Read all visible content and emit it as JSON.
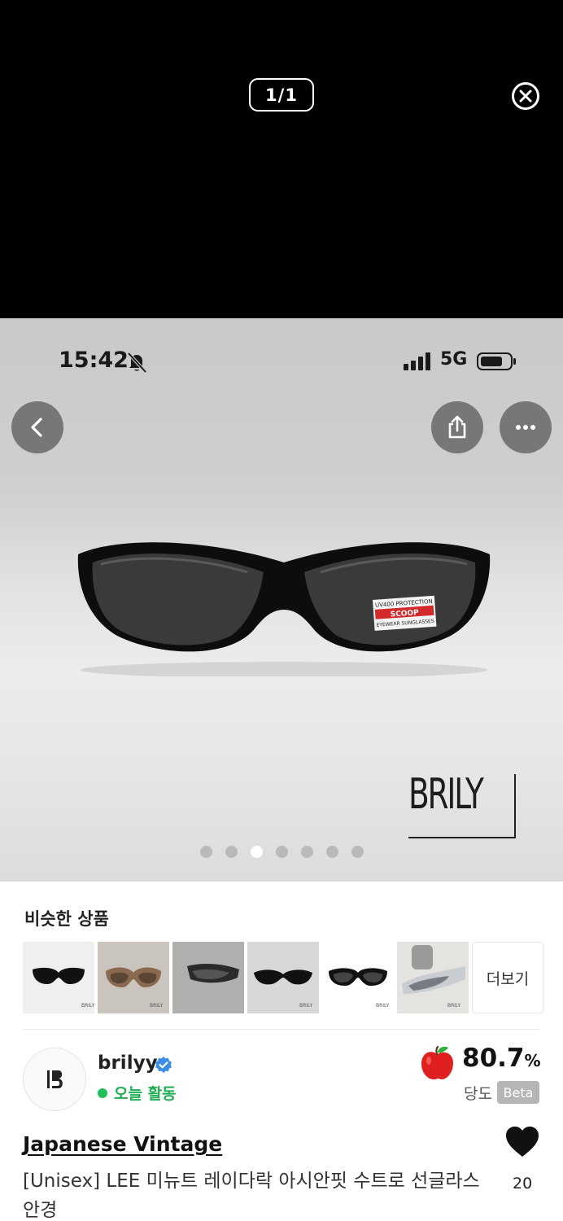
{
  "viewer": {
    "page_counter": "1/1",
    "close_icon": "close-circle-icon"
  },
  "status_bar": {
    "time": "15:42",
    "network": "5G",
    "icons": [
      "bell-off-icon",
      "signal-icon",
      "battery-icon"
    ]
  },
  "photo": {
    "watermark": "BRILY",
    "lens_label": [
      "UV400 PROTECTION",
      "SCOOP",
      "EYEWEAR SUNGLASSES"
    ],
    "carousel": {
      "total": 7,
      "active_index": 2
    },
    "buttons": [
      "back-icon",
      "share-icon",
      "more-icon"
    ]
  },
  "similar": {
    "title": "비슷한 상품",
    "more_label": "더보기",
    "thumb_count": 6
  },
  "seller": {
    "name": "brilyy",
    "activity": "오늘 활동",
    "score": "80.7",
    "score_unit": "%",
    "score_label": "당도",
    "beta": "Beta"
  },
  "product": {
    "shop": "Japanese Vintage",
    "title": "[Unisex] LEE 미뉴트 레이다락 아시안핏 수트로 선글라스 안경",
    "likes": "20"
  },
  "colors": {
    "accent_green": "#1fae53",
    "verified_blue": "#3a8ee6",
    "apple_red": "#e02020"
  }
}
